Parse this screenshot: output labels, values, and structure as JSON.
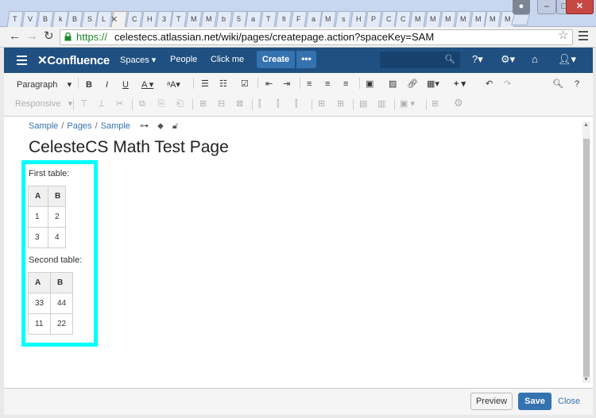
{
  "browser": {
    "tabs": [
      "T",
      "V",
      "B",
      "k",
      "B",
      "S",
      "L",
      "",
      "C",
      "H",
      "3",
      "T",
      "M",
      "M",
      "b",
      "5",
      "a",
      "T",
      "fi",
      "F",
      "a",
      "M",
      "s",
      "H",
      "P",
      "C",
      "C",
      "M",
      "M",
      "M",
      "M",
      "M",
      "M",
      "M"
    ],
    "active_tab_index": 7,
    "url_scheme": "https://",
    "url_host": "celestecs.atlassian.net/wiki/pages/createpage.action?spaceKey=SAM",
    "colors": {
      "url_secure": "#1d8a2c",
      "close_button": "#c74742"
    }
  },
  "header": {
    "logo": "Confluence",
    "spaces": "Spaces",
    "people": "People",
    "click_me": "Click me",
    "create": "Create",
    "more": "•••",
    "bg_color": "#205081"
  },
  "toolbar": {
    "paragraph": "Paragraph",
    "responsive": "Responsive"
  },
  "breadcrumb": [
    "Sample",
    "Pages",
    "Sample"
  ],
  "page": {
    "title": "CelesteCS Math Test Page",
    "first_label": "First table:",
    "second_label": "Second table:",
    "table1": {
      "headers": [
        "A",
        "B"
      ],
      "rows": [
        [
          "1",
          "2"
        ],
        [
          "3",
          "4"
        ]
      ]
    },
    "table2": {
      "headers": [
        "A",
        "B"
      ],
      "rows": [
        [
          "33",
          "44"
        ],
        [
          "11",
          "22"
        ]
      ]
    },
    "highlight_color": "#00ffff"
  },
  "footer": {
    "preview": "Preview",
    "save": "Save",
    "close": "Close"
  }
}
